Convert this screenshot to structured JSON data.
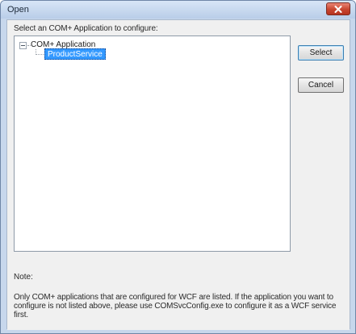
{
  "window": {
    "title": "Open",
    "close_icon": "close-icon",
    "accent_close": "#c8452f"
  },
  "dialog": {
    "instruction": "Select an COM+ Application to configure:",
    "tree": {
      "root_label": "COM+ Application",
      "root_expanded": true,
      "children": [
        {
          "label": "ProductService",
          "selected": true
        }
      ]
    },
    "buttons": {
      "select_label": "Select",
      "cancel_label": "Cancel"
    },
    "note": {
      "label": "Note:",
      "text": "Only COM+ applications that are configured for WCF are listed. If the application you want to configure is not listed above, please use COMSvcConfig.exe to configure it as a WCF service first."
    }
  }
}
